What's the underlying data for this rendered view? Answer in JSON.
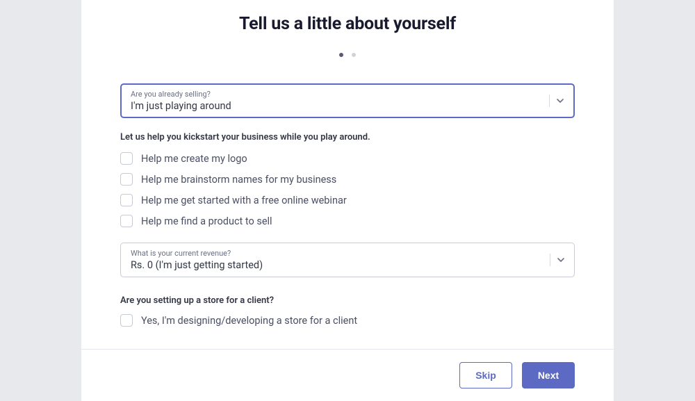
{
  "title": "Tell us a little about yourself",
  "select1": {
    "label": "Are you already selling?",
    "value": "I'm just playing around"
  },
  "help_text": "Let us help you kickstart your business while you play around.",
  "checkboxes": {
    "item0": "Help me create my logo",
    "item1": "Help me brainstorm names for my business",
    "item2": "Help me get started with a free online webinar",
    "item3": "Help me find a product to sell"
  },
  "select2": {
    "label": "What is your current revenue?",
    "value": "Rs. 0 (I'm just getting started)"
  },
  "client_question": "Are you setting up a store for a client?",
  "client_checkbox_label": "Yes, I'm designing/developing a store for a client",
  "buttons": {
    "skip": "Skip",
    "next": "Next"
  }
}
